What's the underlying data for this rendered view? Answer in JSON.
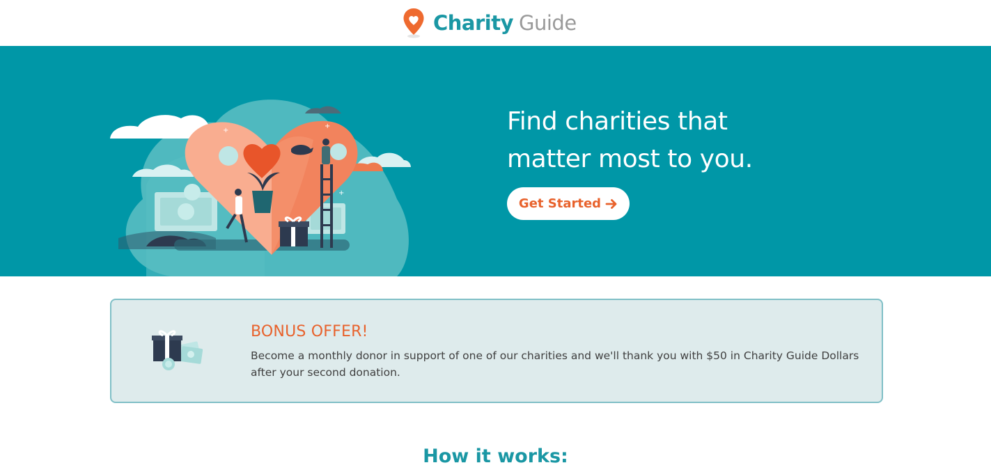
{
  "header": {
    "logo_primary": "Charity",
    "logo_secondary": "Guide"
  },
  "hero": {
    "title_line1": "Find charities that",
    "title_line2": "matter most to you.",
    "cta_label": "Get Started",
    "cta_icon": "arrow-right-icon",
    "illustration_icon": "heart-charity-illustration"
  },
  "offer": {
    "title": "BONUS OFFER!",
    "text": "Become a monthly donor in support of one of our charities and we'll thank you with $50 in Charity Guide Dollars after your second donation.",
    "icon": "gift-money-icon"
  },
  "how_it_works": {
    "title": "How it works:"
  },
  "colors": {
    "brand_teal": "#1a97a4",
    "hero_bg": "#0097a7",
    "accent_orange": "#e8622c",
    "offer_bg": "#deebec",
    "offer_border": "#7fbfc6"
  }
}
